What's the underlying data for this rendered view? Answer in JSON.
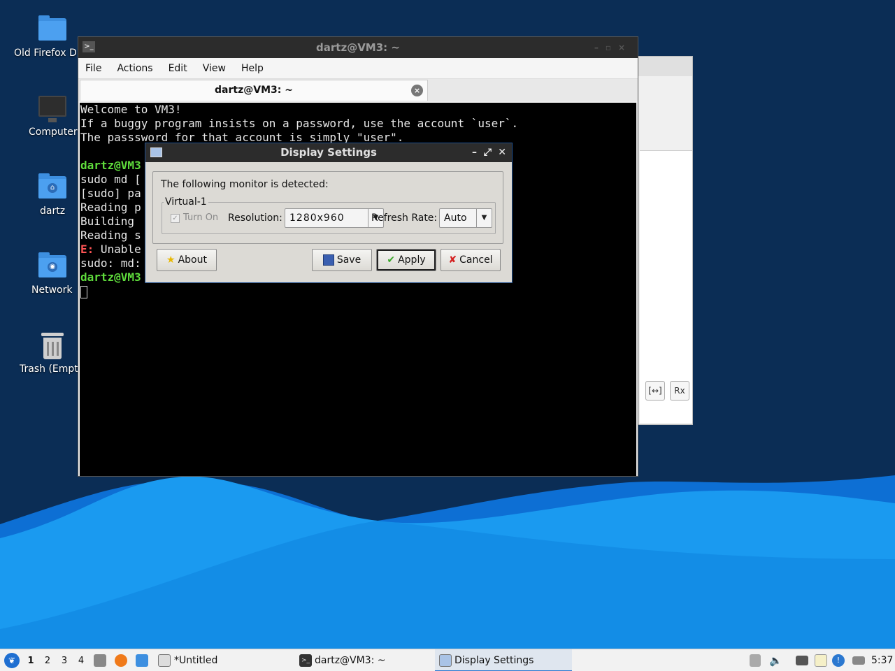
{
  "desktop": {
    "icons": [
      {
        "label": "Old Firefox D",
        "icon": "folder-icon"
      },
      {
        "label": "Computer",
        "icon": "monitor-icon"
      },
      {
        "label": "dartz",
        "icon": "home-folder-icon"
      },
      {
        "label": "Network",
        "icon": "network-folder-icon"
      },
      {
        "label": "Trash (Empt",
        "icon": "trash-icon"
      }
    ]
  },
  "terminal": {
    "title": "dartz@VM3: ~",
    "menu": [
      "File",
      "Actions",
      "Edit",
      "View",
      "Help"
    ],
    "tab_label": "dartz@VM3: ~",
    "lines": {
      "l1": "Welcome to VM3!",
      "l2": "If a buggy program insists on a password, use the account `user`.",
      "l3": "The passsword for that account is simply \"user\".",
      "l5": "dartz@VM3",
      "l6": "sudo md [",
      "l7": "[sudo] pa",
      "l8": "Reading p",
      "l9": "Building ",
      "l10": "Reading s",
      "l11_prefix": "E:",
      "l11": " Unable",
      "l12": "sudo: md:",
      "l13": "dartz@VM3"
    }
  },
  "background_window": {
    "btn1": "[↔]",
    "btn2": "Rx"
  },
  "dialog": {
    "title": "Display Settings",
    "lead": "The following monitor is detected:",
    "monitor_name": "Virtual-1",
    "turn_on_label": "Turn On",
    "resolution_label": "Resolution:",
    "resolution_value": "1280x960",
    "refresh_label": "Refresh Rate:",
    "refresh_value": "Auto",
    "buttons": {
      "about": "About",
      "save": "Save",
      "apply": "Apply",
      "cancel": "Cancel"
    }
  },
  "taskbar": {
    "workspaces": [
      "1",
      "2",
      "3",
      "4"
    ],
    "current_workspace": "1",
    "tasks": [
      "*Untitled",
      "dartz@VM3: ~",
      "Display Settings"
    ],
    "active_task": "Display Settings",
    "clock": "5:37"
  },
  "colors": {
    "desktop_bg": "#0b2d55",
    "wave_light": "#1a9af0",
    "prompt_green": "#5fdc3c",
    "error_red": "#ff5555"
  }
}
